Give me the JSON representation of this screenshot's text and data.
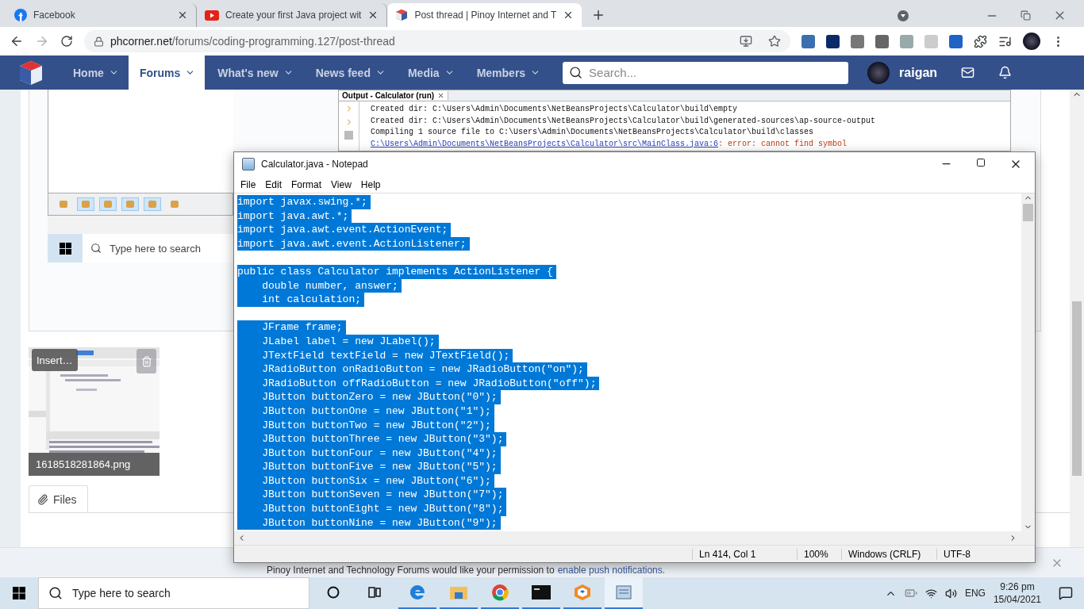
{
  "browser": {
    "tabs": [
      {
        "title": "Facebook",
        "kind": "facebook",
        "selected": false
      },
      {
        "title": "Create your first Java project wit",
        "kind": "youtube",
        "selected": false
      },
      {
        "title": "Post thread | Pinoy Internet and T",
        "kind": "site",
        "selected": true
      }
    ],
    "url_host": "phcorner.net",
    "url_path": "/forums/coding-programming.127/post-thread",
    "forward_disabled": true
  },
  "forum_nav": {
    "items": [
      {
        "label": "Home",
        "selected": false
      },
      {
        "label": "Forums",
        "selected": true
      },
      {
        "label": "What's new",
        "selected": false
      },
      {
        "label": "News feed",
        "selected": false
      },
      {
        "label": "Media",
        "selected": false
      },
      {
        "label": "Members",
        "selected": false
      }
    ],
    "search_placeholder": "Search...",
    "username": "raigan"
  },
  "embedded_screenshot": {
    "output_title": "Output - Calculator (run)",
    "output_lines": [
      {
        "kind": "plain",
        "text": "Created dir: C:\\Users\\Admin\\Documents\\NetBeansProjects\\Calculator\\build\\empty"
      },
      {
        "kind": "plain",
        "text": "Created dir: C:\\Users\\Admin\\Documents\\NetBeansProjects\\Calculator\\build\\generated-sources\\ap-source-output"
      },
      {
        "kind": "plain",
        "text": "Compiling 1 source file to C:\\Users\\Admin\\Documents\\NetBeansProjects\\Calculator\\build\\classes"
      },
      {
        "kind": "error",
        "link": "C:\\Users\\Admin\\Documents\\NetBeansProjects\\Calculator\\src\\MainClass.java:6",
        "text": ": error: cannot find symbol"
      }
    ],
    "taskbar_search_placeholder": "Type here to search"
  },
  "attachment": {
    "insert_label": "Insert…",
    "filename": "1618518281864.png"
  },
  "files_button": "Files",
  "notepad": {
    "title": "Calculator.java - Notepad",
    "menu": [
      "File",
      "Edit",
      "Format",
      "View",
      "Help"
    ],
    "selected": true,
    "lines": [
      {
        "kind": "code",
        "text": "import javax.swing.*;"
      },
      {
        "kind": "code",
        "text": "import java.awt.*;"
      },
      {
        "kind": "code",
        "text": "import java.awt.event.ActionEvent;"
      },
      {
        "kind": "code",
        "text": "import java.awt.event.ActionListener;"
      },
      {
        "kind": "blank"
      },
      {
        "kind": "code",
        "text": "public class Calculator implements ActionListener {"
      },
      {
        "kind": "code",
        "text": "    double number, answer;"
      },
      {
        "kind": "code",
        "text": "    int calculation;"
      },
      {
        "kind": "blank"
      },
      {
        "kind": "code",
        "text": "    JFrame frame;"
      },
      {
        "kind": "code",
        "text": "    JLabel label = new JLabel();"
      },
      {
        "kind": "code",
        "text": "    JTextField textField = new JTextField();"
      },
      {
        "kind": "code",
        "text": "    JRadioButton onRadioButton = new JRadioButton(\"on\");"
      },
      {
        "kind": "code",
        "text": "    JRadioButton offRadioButton = new JRadioButton(\"off\");"
      },
      {
        "kind": "code",
        "text": "    JButton buttonZero = new JButton(\"0\");"
      },
      {
        "kind": "code",
        "text": "    JButton buttonOne = new JButton(\"1\");"
      },
      {
        "kind": "code",
        "text": "    JButton buttonTwo = new JButton(\"2\");"
      },
      {
        "kind": "code",
        "text": "    JButton buttonThree = new JButton(\"3\");"
      },
      {
        "kind": "code",
        "text": "    JButton buttonFour = new JButton(\"4\");"
      },
      {
        "kind": "code",
        "text": "    JButton buttonFive = new JButton(\"5\");"
      },
      {
        "kind": "code",
        "text": "    JButton buttonSix = new JButton(\"6\");"
      },
      {
        "kind": "code",
        "text": "    JButton buttonSeven = new JButton(\"7\");"
      },
      {
        "kind": "code",
        "text": "    JButton buttonEight = new JButton(\"8\");"
      },
      {
        "kind": "code",
        "text": "    JButton buttonNine = new JButton(\"9\");"
      }
    ],
    "status": [
      "Ln 414, Col 1",
      "100%",
      "Windows (CRLF)",
      "UTF-8"
    ]
  },
  "push_notice": {
    "text": "Pinoy Internet and Technology Forums would like your permission to",
    "link": "enable push notifications."
  },
  "taskbar": {
    "search_placeholder": "Type here to search",
    "apps": [
      {
        "kind": "cortana",
        "running": false,
        "selected": false
      },
      {
        "kind": "taskview",
        "running": false,
        "selected": false
      },
      {
        "kind": "edge",
        "running": true,
        "selected": false
      },
      {
        "kind": "explorer",
        "running": true,
        "selected": false
      },
      {
        "kind": "chrome",
        "running": true,
        "selected": false
      },
      {
        "kind": "terminal",
        "running": true,
        "selected": false
      },
      {
        "kind": "netbeans",
        "running": true,
        "selected": false
      },
      {
        "kind": "notepad",
        "running": true,
        "selected": true
      }
    ],
    "language": "ENG",
    "time": "9:26 pm",
    "date": "15/04/2021"
  }
}
